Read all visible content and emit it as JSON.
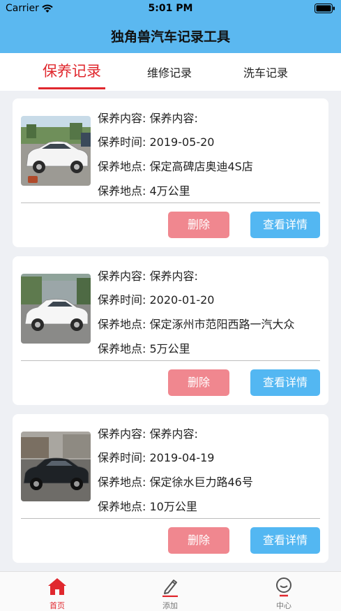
{
  "status": {
    "carrier": "Carrier",
    "time": "5:01 PM"
  },
  "app": {
    "title": "独角兽汽车记录工具"
  },
  "tabs": [
    {
      "label": "保养记录",
      "active": true
    },
    {
      "label": "维修记录",
      "active": false
    },
    {
      "label": "洗车记录",
      "active": false
    }
  ],
  "records": [
    {
      "content": "保养内容: 保养内容:",
      "time": "保养时间: 2019-05-20",
      "place": "保养地点: 保定高碑店奥迪4S店",
      "mileage": "保养地点: 4万公里",
      "delete_label": "删除",
      "detail_label": "查看详情"
    },
    {
      "content": "保养内容: 保养内容:",
      "time": "保养时间: 2020-01-20",
      "place": "保养地点: 保定涿州市范阳西路一汽大众",
      "mileage": "保养地点: 5万公里",
      "delete_label": "删除",
      "detail_label": "查看详情"
    },
    {
      "content": "保养内容: 保养内容:",
      "time": "保养时间: 2019-04-19",
      "place": "保养地点: 保定徐水巨力路46号",
      "mileage": "保养地点: 10万公里",
      "delete_label": "删除",
      "detail_label": "查看详情"
    }
  ],
  "tabbar": [
    {
      "label": "首页",
      "icon": "home-icon",
      "active": true
    },
    {
      "label": "添加",
      "icon": "pencil-icon",
      "active": false
    },
    {
      "label": "中心",
      "icon": "profile-icon",
      "active": false
    }
  ],
  "colors": {
    "header": "#5bb8f0",
    "accent_red": "#e0282e",
    "delete_button": "#f0878f",
    "detail_button": "#53b7f2",
    "background": "#eef0f4"
  }
}
